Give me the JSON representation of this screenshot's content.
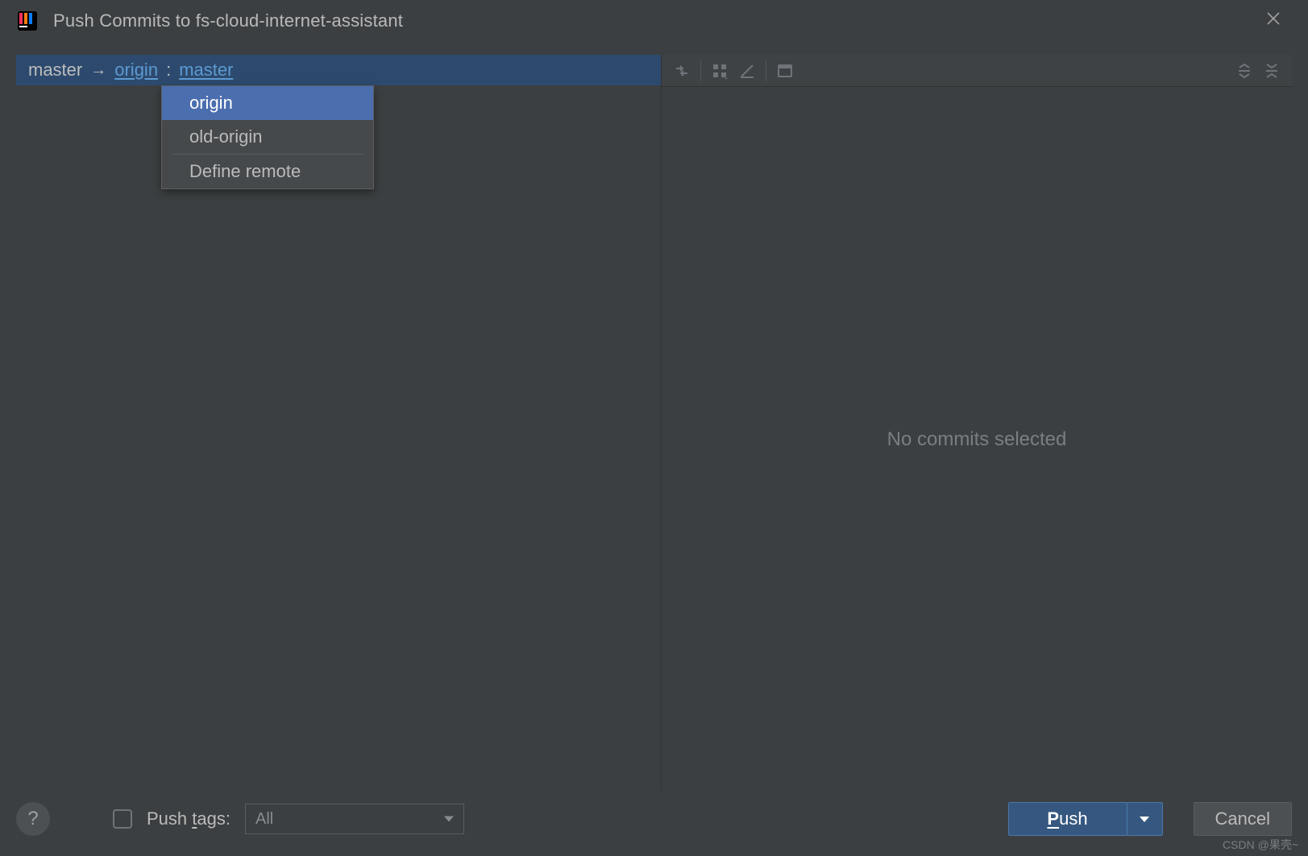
{
  "window": {
    "title": "Push Commits to fs-cloud-internet-assistant"
  },
  "branch": {
    "local": "master",
    "remote_link": "origin",
    "target_link": "master"
  },
  "remote_dropdown": {
    "items": [
      {
        "label": "origin",
        "selected": true
      },
      {
        "label": "old-origin",
        "selected": false
      },
      {
        "label": "Define remote",
        "selected": false,
        "separator_before": true
      }
    ]
  },
  "right": {
    "empty_text": "No commits selected"
  },
  "footer": {
    "push_tags_label_pre": "Push ",
    "push_tags_label_ul": "t",
    "push_tags_label_post": "ags:",
    "push_tags_select_value": "All",
    "push_button_ul": "P",
    "push_button_post": "ush",
    "cancel_button": "Cancel"
  },
  "watermark": "CSDN @果壳~"
}
